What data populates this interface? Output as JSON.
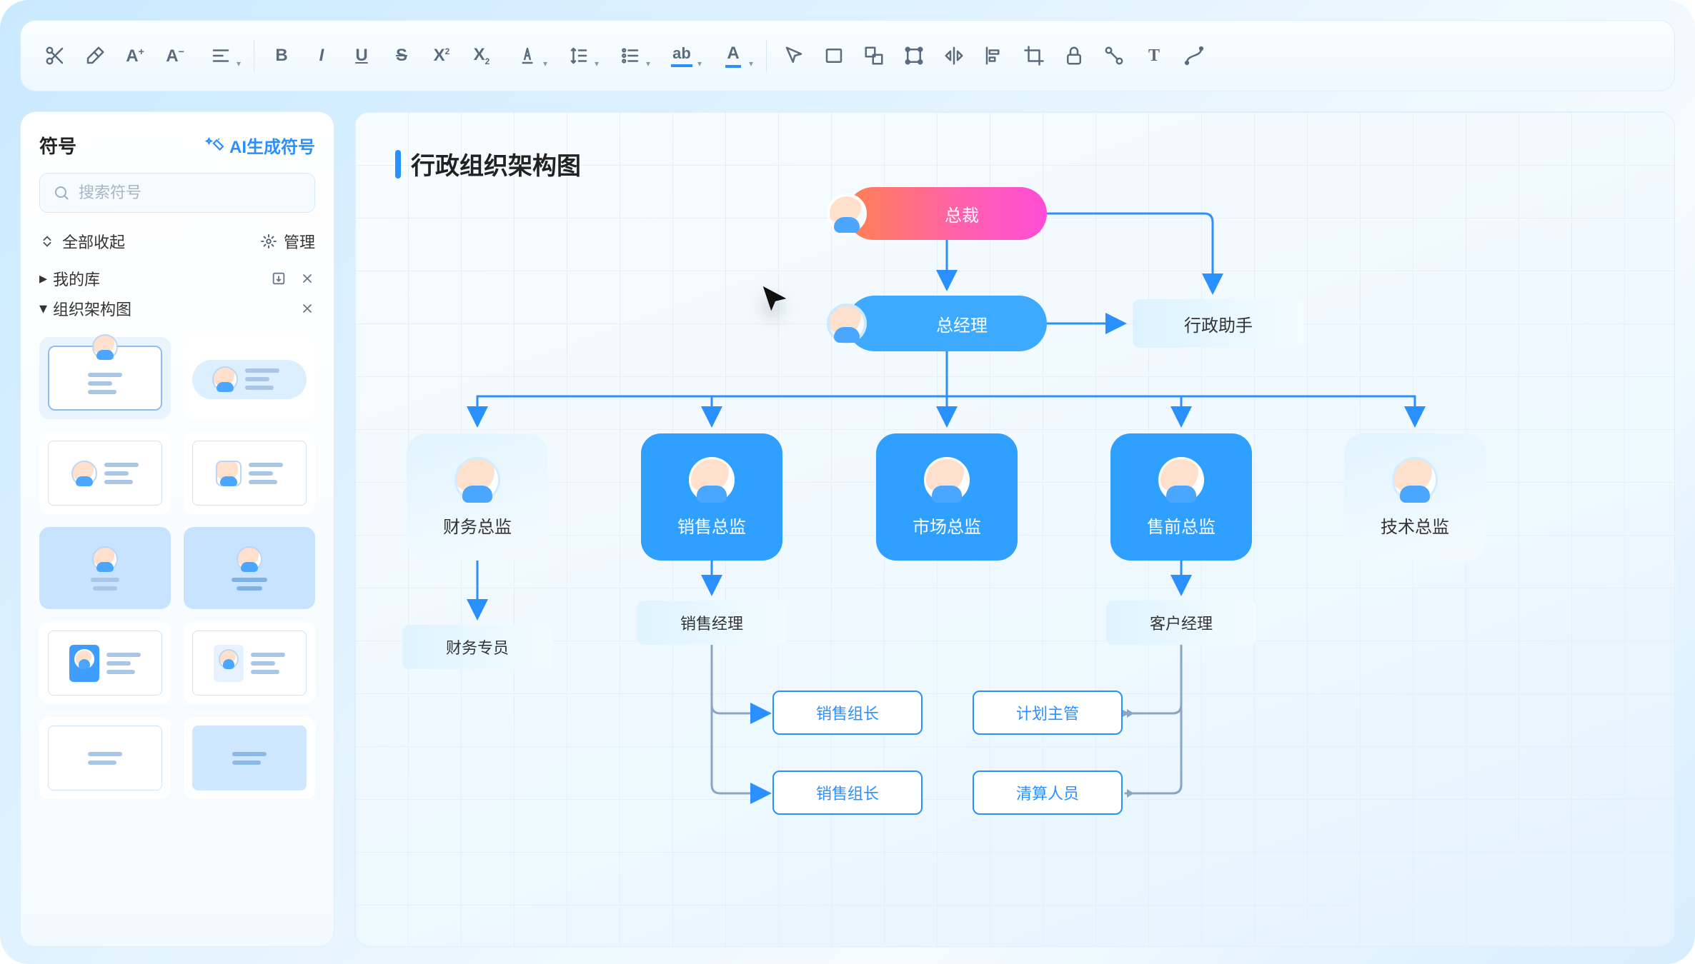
{
  "toolbar": {
    "icons": [
      "scissors-icon",
      "eraser-icon",
      "font-increase-icon",
      "font-decrease-icon",
      "align-icon",
      "bold-icon",
      "italic-icon",
      "underline-icon",
      "strike-icon",
      "superscript-icon",
      "subscript-icon",
      "text-color-icon",
      "line-height-icon",
      "list-bullet-icon",
      "highlight-icon",
      "font-color-a-icon",
      "pointer-icon",
      "rectangle-icon",
      "group-icon",
      "bounding-icon",
      "flip-h-icon",
      "align-left-obj-icon",
      "crop-icon",
      "lock-icon",
      "connector-icon",
      "text-tool-icon",
      "bezier-icon"
    ]
  },
  "sidebar": {
    "title": "符号",
    "ai_gen_label": "AI生成符号",
    "search_placeholder": "搜索符号",
    "collapse_all": "全部收起",
    "manage": "管理",
    "my_library": "我的库",
    "org_chart_cat": "组织架构图"
  },
  "canvas": {
    "title": "行政组织架构图",
    "nodes": {
      "president": "总裁",
      "gm": "总经理",
      "assistant": "行政助手",
      "finance_dir": "财务总监",
      "sales_dir": "销售总监",
      "market_dir": "市场总监",
      "presales_dir": "售前总监",
      "tech_dir": "技术总监",
      "finance_spec": "财务专员",
      "sales_mgr": "销售经理",
      "cust_mgr": "客户经理",
      "sales_lead1": "销售组长",
      "sales_lead2": "销售组长",
      "plan_sup": "计划主管",
      "settle_staff": "清算人员"
    }
  }
}
